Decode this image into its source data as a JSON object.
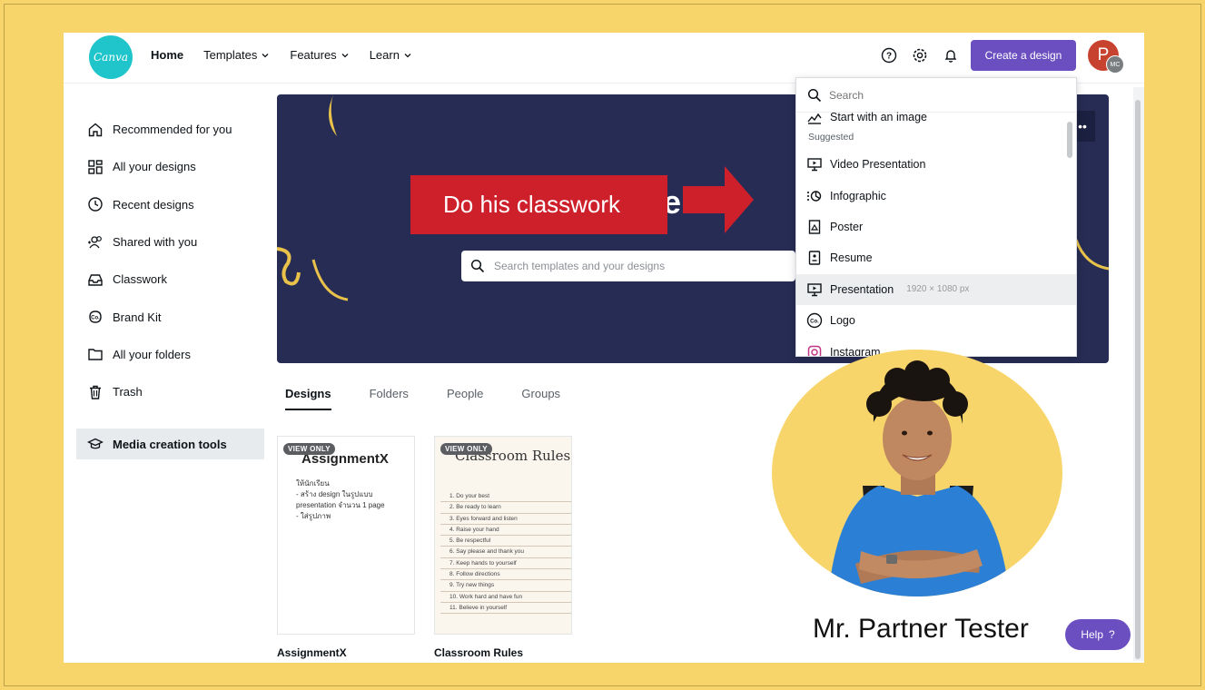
{
  "app": {
    "logo_text": "Canva",
    "nav": [
      {
        "label": "Home"
      },
      {
        "label": "Templates"
      },
      {
        "label": "Features"
      },
      {
        "label": "Learn"
      }
    ],
    "create_button": "Create a design",
    "avatar_initial": "P",
    "avatar_badge": "MC",
    "accent_color": "#6b4fc1"
  },
  "sidebar": {
    "items": [
      {
        "label": "Recommended for you",
        "icon": "home-icon"
      },
      {
        "label": "All your designs",
        "icon": "grid-icon"
      },
      {
        "label": "Recent designs",
        "icon": "clock-icon"
      },
      {
        "label": "Shared with you",
        "icon": "people-icon"
      },
      {
        "label": "Classwork",
        "icon": "inbox-icon"
      },
      {
        "label": "Brand Kit",
        "icon": "brand-kit-icon"
      },
      {
        "label": "All your folders",
        "icon": "folder-icon"
      },
      {
        "label": "Trash",
        "icon": "trash-icon"
      }
    ],
    "media_tools": "Media creation tools"
  },
  "hero": {
    "title_visible": "e    n t",
    "search_placeholder": "Search templates and your designs",
    "more": "••"
  },
  "tabs": [
    "Designs",
    "Folders",
    "People",
    "Groups"
  ],
  "designs": [
    {
      "name": "AssignmentX",
      "badge": "VIEW ONLY",
      "preview_title": "AssignmentX",
      "preview_body": "ให้นักเรียน\n- สร้าง design ในรูปแบบ\npresentation จำนวน 1 page\n- ใส่รูปภาพ"
    },
    {
      "name": "Classroom Rules",
      "badge": "VIEW ONLY",
      "preview_title": "Classroom Rules",
      "rules": [
        "1. Do your best",
        "2. Be ready to learn",
        "3. Eyes forward and listen",
        "4. Raise your hand",
        "5. Be respectful",
        "6. Say please and thank you",
        "7. Keep hands to yourself",
        "8. Follow directions",
        "9. Try new things",
        "10. Work hard and have fun",
        "11. Believe in yourself"
      ]
    }
  ],
  "dropdown": {
    "search_placeholder": "Search",
    "first_item": "Start with an image",
    "section": "Suggested",
    "items": [
      {
        "label": "Video Presentation",
        "dims": ""
      },
      {
        "label": "Infographic",
        "dims": ""
      },
      {
        "label": "Poster",
        "dims": ""
      },
      {
        "label": "Resume",
        "dims": ""
      },
      {
        "label": "Presentation",
        "dims": "1920 × 1080 px"
      },
      {
        "label": "Logo",
        "dims": ""
      },
      {
        "label": "Instagram",
        "dims": ""
      }
    ]
  },
  "overlay": {
    "callout_text": "Do his classwork",
    "callout_color": "#cd202b",
    "person_name": "Mr. Partner Tester"
  },
  "help": {
    "label": "Help",
    "icon": "?"
  }
}
